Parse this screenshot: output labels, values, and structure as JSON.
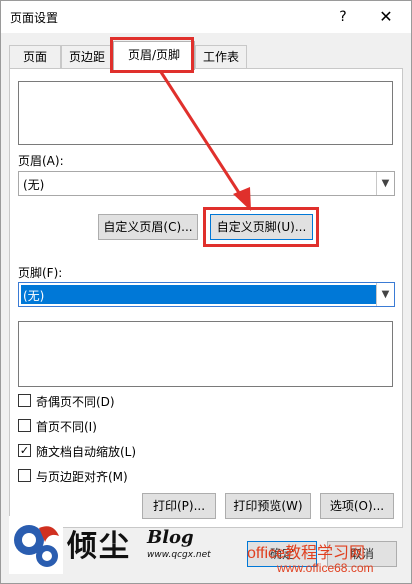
{
  "window": {
    "title": "页面设置",
    "help": "?",
    "close": "✕"
  },
  "tabs": [
    "页面",
    "页边距",
    "页眉/页脚",
    "工作表"
  ],
  "header": {
    "label": "页眉(A):",
    "value": "(无)",
    "custom_button": "自定义页眉(C)..."
  },
  "footer": {
    "label": "页脚(F):",
    "value": "(无)",
    "custom_button": "自定义页脚(U)..."
  },
  "options": [
    {
      "label": "奇偶页不同(D)",
      "checked": false
    },
    {
      "label": "首页不同(I)",
      "checked": false
    },
    {
      "label": "随文档自动缩放(L)",
      "checked": true
    },
    {
      "label": "与页边距对齐(M)",
      "checked": false
    }
  ],
  "buttons": {
    "print": "打印(P)...",
    "preview": "打印预览(W)",
    "options": "选项(O)...",
    "ok": "确定",
    "cancel": "取消"
  },
  "watermark": {
    "brand": "倾尘",
    "blog": "Blog",
    "url": "www.qcgx.net",
    "site": "office教程学习网",
    "site_url": "www.office68.com"
  },
  "colors": {
    "annotation": "#e0302c",
    "selection": "#0078d7"
  }
}
